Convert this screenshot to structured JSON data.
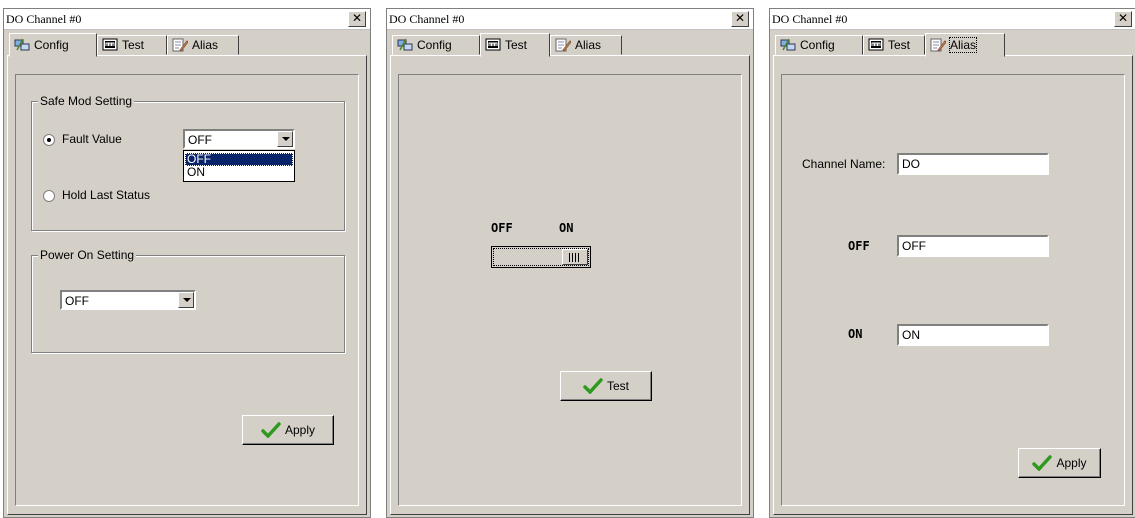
{
  "windows": [
    {
      "title": "DO Channel #0",
      "close": "✕",
      "tabs": [
        "Config",
        "Test",
        "Alias"
      ],
      "active_tab": "Config",
      "safe_mode": {
        "legend": "Safe Mod Setting",
        "fault_value_label": "Fault Value",
        "fault_value_selected": "OFF",
        "fault_value_checked": true,
        "dropdown_options": [
          "OFF",
          "ON"
        ],
        "hold_last_label": "Hold Last Status"
      },
      "power_on": {
        "legend": "Power On Setting",
        "selected": "OFF"
      },
      "apply_label": "Apply"
    },
    {
      "title": "DO Channel #0",
      "close": "✕",
      "tabs": [
        "Config",
        "Test",
        "Alias"
      ],
      "active_tab": "Test",
      "switch": {
        "off_label": "OFF",
        "on_label": "ON",
        "state": "ON"
      },
      "test_label": "Test"
    },
    {
      "title": "DO Channel #0",
      "close": "✕",
      "tabs": [
        "Config",
        "Test",
        "Alias"
      ],
      "active_tab": "Alias",
      "channel_name_label": "Channel Name:",
      "channel_name_value": "DO",
      "off_label": "OFF",
      "off_value": "OFF",
      "on_label": "ON",
      "on_value": "ON",
      "apply_label": "Apply"
    }
  ],
  "icons": {
    "config": "network-config-icon",
    "test": "monitor-icon",
    "alias": "notepad-pencil-icon",
    "apply": "checkmark-icon"
  },
  "colors": {
    "selection": "#0a246a",
    "check": "#2e9a1e",
    "face": "#d4d0c8"
  }
}
